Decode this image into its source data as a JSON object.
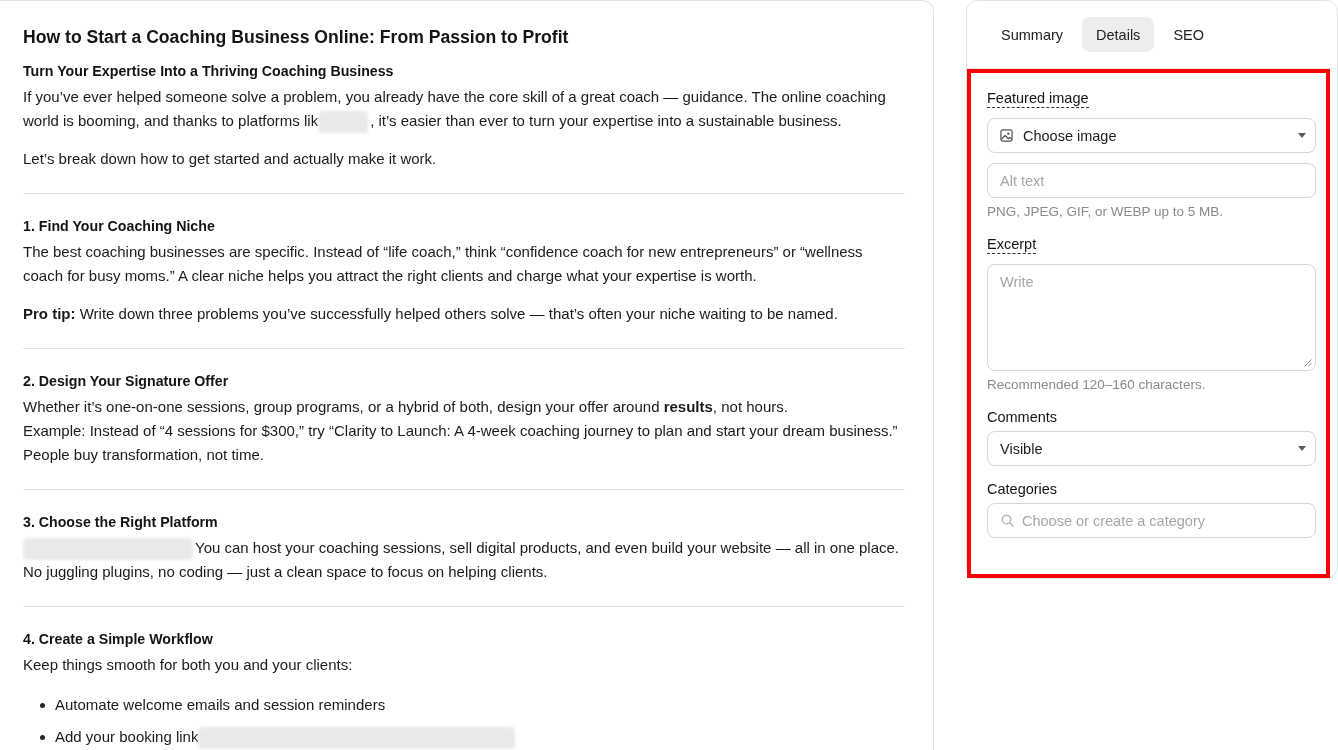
{
  "article": {
    "title": "How to Start a Coaching Business Online: From Passion to Profit",
    "sections": [
      {
        "heading": "Turn Your Expertise Into a Thriving Coaching Business",
        "blocks": [
          {
            "kind": "mixed_paragraph",
            "parts": [
              {
                "kind": "text",
                "text": "If you’ve ever helped someone solve a problem, you already have the core skill of a great coach — guidance. The online coaching world is booming, and thanks to platforms lik"
              },
              {
                "kind": "blur"
              },
              {
                "kind": "text",
                "text": ", it’s easier than ever to turn your expertise into a sustainable business."
              }
            ]
          },
          {
            "kind": "paragraph",
            "lines": [
              "Let’s break down how to get started and actually make it work."
            ]
          }
        ]
      },
      {
        "heading": "1. Find Your Coaching Niche",
        "blocks": [
          {
            "kind": "paragraph",
            "lines": [
              "The best coaching businesses are specific. Instead of “life coach,” think “confidence coach for new entrepreneurs” or “wellness coach for busy moms.” A clear niche helps you attract the right clients and charge what your expertise is worth."
            ]
          },
          {
            "kind": "paragraph",
            "lines": [
              "**Pro tip:** Write down three problems you’ve successfully helped others solve — that’s often your niche waiting to be named."
            ]
          }
        ]
      },
      {
        "heading": "2. Design Your Signature Offer",
        "blocks": [
          {
            "kind": "paragraph",
            "lines": [
              "Whether it’s one-on-one sessions, group programs, or a hybrid of both, design your offer around **results**, not hours.",
              "Example: Instead of “4 sessions for $300,” try “Clarity to Launch: A 4-week coaching journey to plan and start your dream business.” People buy transformation, not time."
            ]
          }
        ]
      },
      {
        "heading": "3. Choose the Right Platform",
        "blocks": [
          {
            "kind": "mixed_paragraph",
            "parts": [
              {
                "kind": "blur"
              },
              {
                "kind": "text",
                "text": "You can host your coaching sessions, sell digital products, and even build your website — all in one place. No juggling plugins, no coding — just a clean space to focus on helping clients."
              }
            ]
          }
        ]
      },
      {
        "heading": "4. Create a Simple Workflow",
        "blocks": [
          {
            "kind": "paragraph",
            "lines": [
              "Keep things smooth for both you and your clients:"
            ]
          },
          {
            "kind": "bullet_list",
            "items": [
              {
                "parts": [
                  {
                    "kind": "text",
                    "text": "Automate welcome emails and session reminders"
                  }
                ]
              },
              {
                "parts": [
                  {
                    "kind": "text",
                    "text": "Add your booking link"
                  },
                  {
                    "kind": "blur"
                  }
                ]
              }
            ]
          }
        ]
      }
    ]
  },
  "sidebar": {
    "tabs": [
      {
        "label": "Summary",
        "selected": false
      },
      {
        "label": "Details",
        "selected": true
      },
      {
        "label": "SEO",
        "selected": false
      }
    ],
    "details": {
      "highlighted": true,
      "groups": [
        {
          "label": "Featured image",
          "has_tooltip": true,
          "controls": [
            {
              "kind": "image_select",
              "value": "Choose image"
            },
            {
              "kind": "text",
              "placeholder": "Alt text"
            }
          ],
          "help": "PNG, JPEG, GIF, or WEBP up to 5 MB."
        },
        {
          "label": "Excerpt",
          "has_tooltip": true,
          "controls": [
            {
              "kind": "textarea",
              "placeholder": "Write"
            }
          ],
          "help": "Recommended 120–160 characters."
        },
        {
          "label": "Comments",
          "has_tooltip": false,
          "controls": [
            {
              "kind": "select",
              "value": "Visible"
            }
          ]
        },
        {
          "label": "Categories",
          "has_tooltip": false,
          "controls": [
            {
              "kind": "search",
              "placeholder": "Choose or create a category"
            }
          ]
        }
      ]
    }
  }
}
